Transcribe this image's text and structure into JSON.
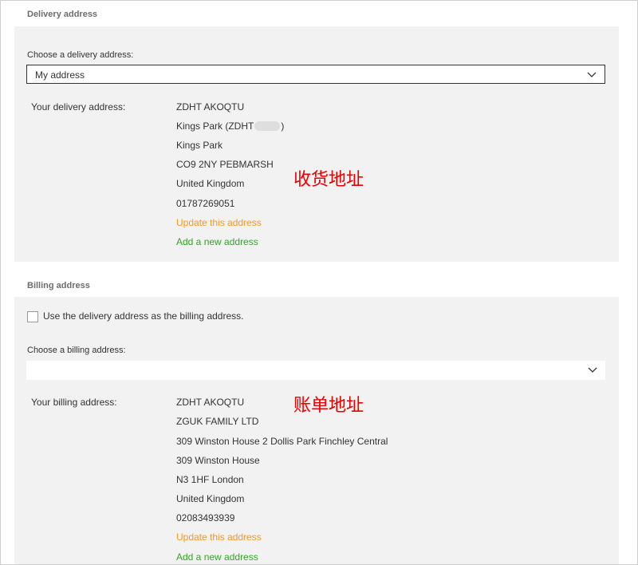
{
  "delivery": {
    "section_title": "Delivery address",
    "choose_label": "Choose a delivery address:",
    "select_value": "My address",
    "address_label": "Your delivery address:",
    "lines": [
      "ZDHT AKOQTU",
      "Kings Park (ZDHT",
      "Kings Park",
      "CO9 2NY PEBMARSH",
      "United Kingdom",
      "01787269051"
    ],
    "line2_suffix": ")",
    "update_link": "Update this address",
    "add_link": "Add a new address",
    "annotation": "收货地址"
  },
  "billing": {
    "section_title": "Billing address",
    "checkbox_label": "Use the delivery address as the billing address.",
    "checkbox_checked": false,
    "choose_label": "Choose a billing address:",
    "select_value": "",
    "address_label": "Your billing address:",
    "lines": [
      "ZDHT AKOQTU",
      "ZGUK FAMILY LTD",
      "309 Winston House 2 Dollis Park Finchley Central",
      "309 Winston House",
      "N3 1HF London",
      "United Kingdom",
      "02083493939"
    ],
    "update_link": "Update this address",
    "add_link": "Add a new address",
    "annotation": "账单地址"
  },
  "colors": {
    "panel_bg": "#f2f2f2",
    "update_link": "#f29a26",
    "add_link": "#3a9f2e",
    "annotation": "#e60000"
  },
  "icons": {
    "select_chevron": "chevron-down-icon"
  }
}
